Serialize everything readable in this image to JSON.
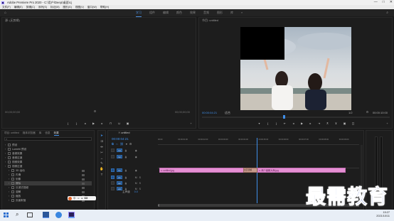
{
  "app": {
    "title": "Adobe Premiere Pro 2020 - C:\\用户\\Deep\\桌面\\cj",
    "window_controls": [
      "—",
      "□",
      "✕"
    ]
  },
  "menu": [
    "文件(F)",
    "编辑(E)",
    "剪辑(C)",
    "序列(S)",
    "标记(M)",
    "图形(G)",
    "视图(V)",
    "窗口(W)",
    "帮助(H)"
  ],
  "workspace_tabs": [
    "学习",
    "组件",
    "编辑",
    "颜色",
    "效果",
    "音频",
    "图形",
    "库",
    "»"
  ],
  "workspace_active": 0,
  "source_panel": {
    "title": "源: (无剪辑)",
    "timecode_left": "00;00;00;00",
    "timecode_right": "00;00;00;00"
  },
  "program_panel": {
    "title": "节目: untitled",
    "timecode": "00:00:04:21",
    "fit_label": "适合",
    "quality": "1/2",
    "duration": "00:00:10:00",
    "progress": 0.43
  },
  "effects_panel": {
    "tabs": [
      "项目: untitled",
      "媒体浏览器",
      "库",
      "信息",
      "效果"
    ],
    "active_tab": 4,
    "items": [
      {
        "label": "预设",
        "level": 0
      },
      {
        "label": "Lumetri 预设",
        "level": 0
      },
      {
        "label": "音频效果",
        "level": 0
      },
      {
        "label": "音频过渡",
        "level": 0
      },
      {
        "label": "视频效果",
        "level": 0
      },
      {
        "label": "视频过渡",
        "level": 0
      },
      {
        "label": "3D 运动",
        "level": 1
      },
      {
        "label": "内滑",
        "level": 1
      },
      {
        "label": "划像",
        "level": 1
      },
      {
        "label": "擦除",
        "level": 1
      },
      {
        "label": "沉浸式视频",
        "level": 1
      },
      {
        "label": "溶解",
        "level": 1
      },
      {
        "label": "缩放",
        "level": 1
      },
      {
        "label": "页面剥落",
        "level": 1
      }
    ],
    "selected_index": 9
  },
  "timeline": {
    "tab": "untitled",
    "timecode": "00:00:04:21",
    "ruler": [
      "00:00",
      "00:00:01:00",
      "00:00:02:00",
      "00:00:03:00",
      "00:00:04:00",
      "00:00:05:00",
      "00:00:06:00",
      "00:00:07:00",
      "00:00:08:00",
      "00:00:09:00"
    ],
    "tracks": [
      {
        "name": "V3"
      },
      {
        "name": "V2"
      },
      {
        "name": "V1"
      },
      {
        "name": "A1"
      },
      {
        "name": "A2"
      },
      {
        "name": "A3"
      }
    ],
    "master": "主声道",
    "master_value": "0.0",
    "clip1": "untitled.jpg",
    "clip2": "两个面朝大海.jpg",
    "transition": "交叉溶解",
    "playhead_fraction": 0.49
  },
  "watermark": "最需教育",
  "taskbar": {
    "time": "15:27",
    "date": "2021/10/11",
    "lang": "中"
  },
  "colors": {
    "accent": "#3f8ee8",
    "clip": "#e58fd3",
    "watermark": "#1f3fb8"
  }
}
